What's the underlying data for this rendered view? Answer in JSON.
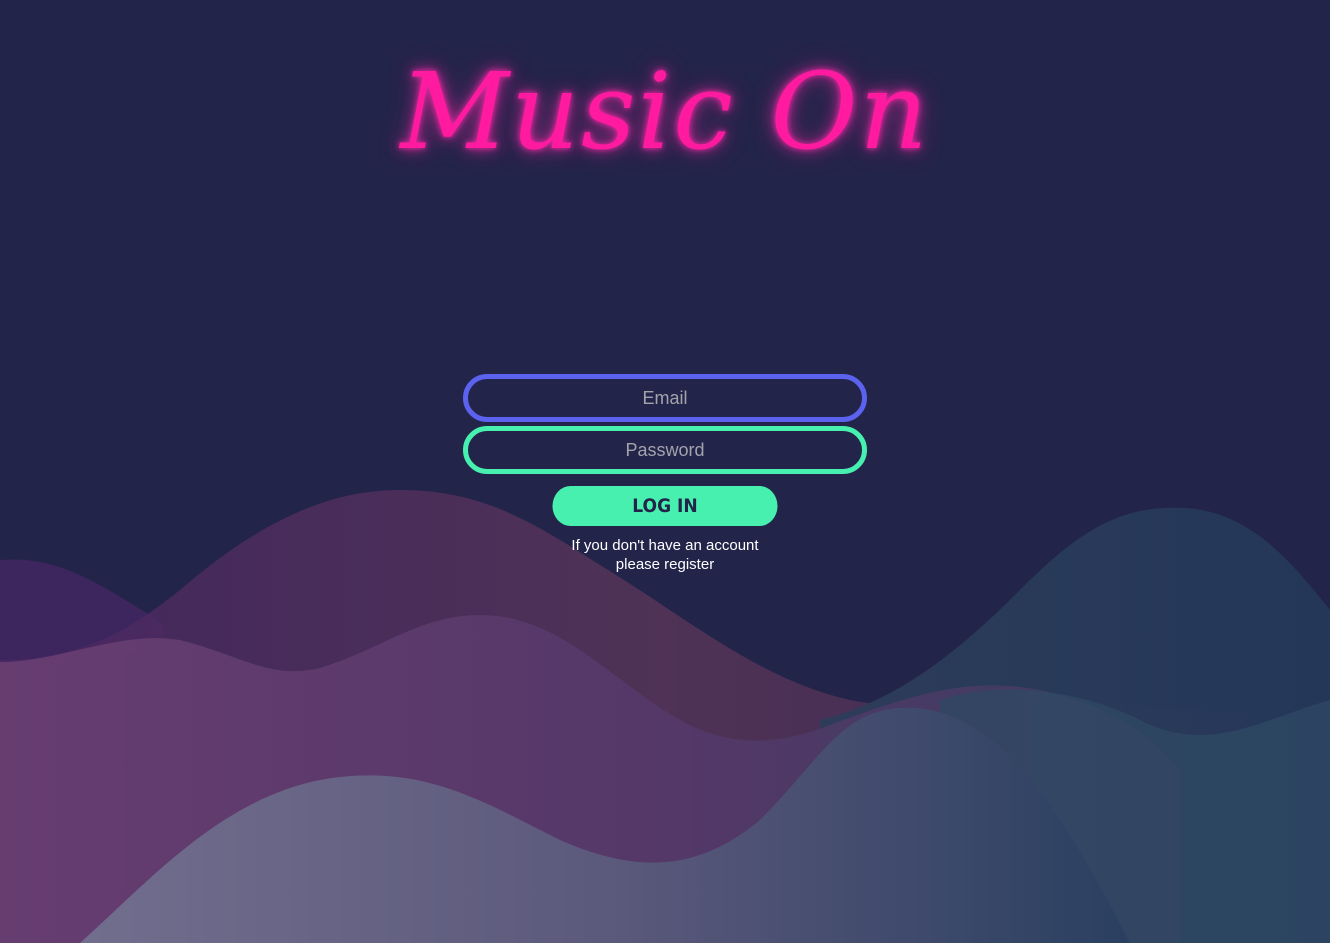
{
  "app": {
    "logo_text": "Music On"
  },
  "login_form": {
    "email_placeholder": "Email",
    "email_value": "",
    "password_placeholder": "Password",
    "password_value": "",
    "login_button_label": "LOG IN",
    "register_prompt_line1": "If you don't have an account",
    "register_prompt_line2": "please register"
  },
  "colors": {
    "background": "#23244a",
    "logo_neon_pink": "#ff1aa0",
    "email_border": "#5b63ee",
    "password_border": "#48f0b0",
    "login_button": "#48f0b0",
    "wave_purple": "#6b3f7a",
    "wave_lavender": "#6f6f92",
    "wave_teal": "#2e4a66"
  }
}
